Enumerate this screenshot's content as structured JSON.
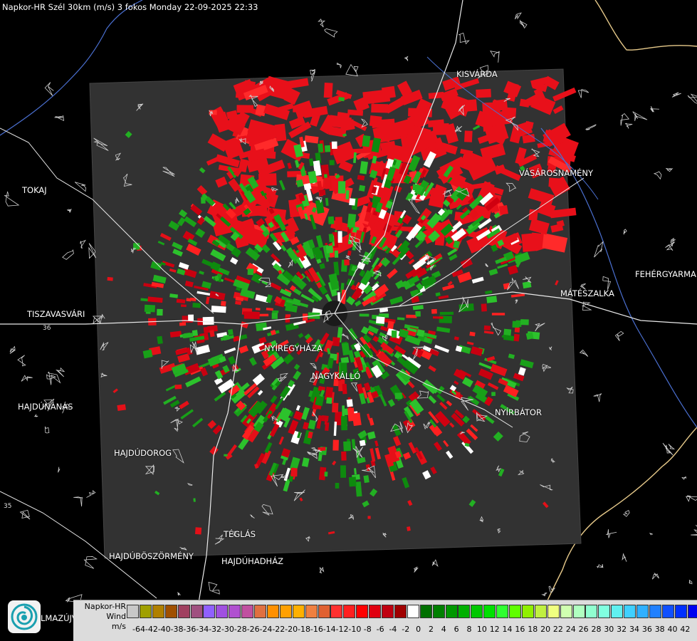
{
  "header": {
    "title": "Napkor-HR Szél 30km (m/s) 3 fokos Monday 22-09-2025 22:33"
  },
  "cities": [
    {
      "key": "kisvarda",
      "name": "KISVÁRDA"
    },
    {
      "key": "tokaj",
      "name": "TOKAJ"
    },
    {
      "key": "vasarosnameny",
      "name": "VÁSÁROSNAMÉNY"
    },
    {
      "key": "fehergyarmat",
      "name": "FEHÉRGYARMA"
    },
    {
      "key": "mateszalka",
      "name": "MÁTÉSZALKA"
    },
    {
      "key": "tiszavasvari",
      "name": "TISZAVASVÁRI"
    },
    {
      "key": "nyiregyhaza",
      "name": "NYÍREGYHÁZA"
    },
    {
      "key": "nagykallo",
      "name": "NAGYKÁLLÓ"
    },
    {
      "key": "hajdunanas",
      "name": "HAJDÚNÁNÁS"
    },
    {
      "key": "nyirbator",
      "name": "NYÍRBÁTOR"
    },
    {
      "key": "hajdudorog",
      "name": "HAJDÚDOROG"
    },
    {
      "key": "teglas",
      "name": "TÉGLÁS"
    },
    {
      "key": "hajduboszormeny",
      "name": "HAJDÚBÖSZÖRMÉNY"
    },
    {
      "key": "hajduhadhaz",
      "name": "HAJDÚHADHÁZ"
    },
    {
      "key": "almazujvaros",
      "name": "LMAZÚJVÁR"
    }
  ],
  "road_numbers": [
    "36",
    "35"
  ],
  "legend": {
    "line1": "Napkor-HR",
    "line2": "Wind",
    "line3": "m/s",
    "colors": [
      "#c8c8c8",
      "#a0a000",
      "#b08000",
      "#a05000",
      "#a04060",
      "#a05080",
      "#9060ff",
      "#a050e0",
      "#b050d0",
      "#c050a0",
      "#e07040",
      "#ff9000",
      "#ffa000",
      "#ffb000",
      "#f08040",
      "#e06030",
      "#ff3030",
      "#ff2020",
      "#ff0000",
      "#e00010",
      "#c00010",
      "#a00000",
      "#ffffff",
      "#007000",
      "#008000",
      "#009800",
      "#00b000",
      "#00c800",
      "#00e000",
      "#30ff30",
      "#60ff00",
      "#90f000",
      "#c0f040",
      "#f0ff80",
      "#d0ffb0",
      "#b0ffc0",
      "#90ffd0",
      "#80ffe0",
      "#60f0f0",
      "#40d0ff",
      "#30b0ff",
      "#2080ff",
      "#1050ff",
      "#0030ff",
      "#0000f0"
    ],
    "ticks": [
      "-64",
      "-42",
      "-40",
      "-38",
      "-36",
      "-34",
      "-32",
      "-30",
      "-28",
      "-26",
      "-24",
      "-22",
      "-20",
      "-18",
      "-16",
      "-14",
      "-12",
      "-10",
      "-8",
      "-6",
      "-4",
      "-2",
      "0",
      "2",
      "4",
      "6",
      "8",
      "10",
      "12",
      "14",
      "16",
      "18",
      "20",
      "22",
      "24",
      "26",
      "28",
      "30",
      "32",
      "34",
      "36",
      "38",
      "40",
      "42"
    ]
  }
}
